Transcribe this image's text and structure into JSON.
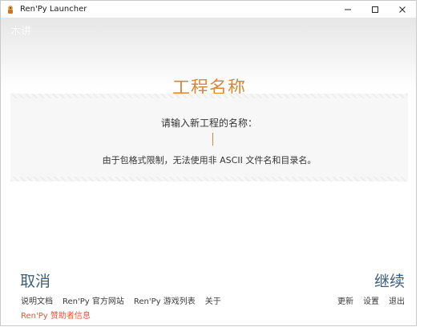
{
  "window": {
    "title": "Ren'Py Launcher",
    "controls": [
      "minimize-icon",
      "maximize-icon",
      "close-icon"
    ]
  },
  "background_label": "木讲",
  "heading": "工程名称",
  "prompt": "请输入新工程的名称：",
  "input": {
    "value": ""
  },
  "note": "由于包格式限制，无法使用非 ASCII 文件名和目录名。",
  "actions": {
    "cancel": "取消",
    "continue": "继续"
  },
  "footer": {
    "left_links": [
      "说明文档",
      "Ren'Py 官方网站",
      "Ren'Py 游戏列表",
      "关于"
    ],
    "right_links": [
      "更新",
      "设置",
      "退出"
    ],
    "sponsor": "Ren'Py 赞助者信息"
  },
  "colors": {
    "accent": "#d6873a",
    "action_text": "#3f5f7a",
    "sponsor": "#d85a3a"
  }
}
